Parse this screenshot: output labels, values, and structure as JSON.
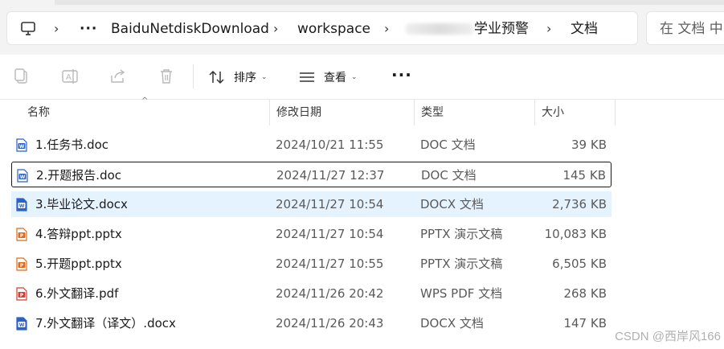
{
  "address_bar": {
    "more_glyph": "···",
    "segments": [
      "BaiduNetdiskDownload",
      "workspace",
      "学业预警",
      "文档"
    ],
    "chevron": "›"
  },
  "search": {
    "placeholder": "在 文档 中"
  },
  "toolbar": {
    "sort_label": "排序",
    "view_label": "查看",
    "more_glyph": "···",
    "caret": "⌄"
  },
  "columns": {
    "name": "名称",
    "modified": "修改日期",
    "type": "类型",
    "size": "大小",
    "sort_indicator": "^"
  },
  "files": [
    {
      "name": "1.任务书.doc",
      "modified": "2024/10/21 11:55",
      "type": "DOC 文档",
      "size": "39 KB",
      "icon": "word-doc-icon",
      "state": "normal"
    },
    {
      "name": "2.开题报告.doc",
      "modified": "2024/11/27 12:37",
      "type": "DOC 文档",
      "size": "145 KB",
      "icon": "word-doc-icon",
      "state": "focused"
    },
    {
      "name": "3.毕业论文.docx",
      "modified": "2024/11/27 10:54",
      "type": "DOCX 文档",
      "size": "2,736 KB",
      "icon": "word-docx-icon",
      "state": "selected"
    },
    {
      "name": "4.答辩ppt.pptx",
      "modified": "2024/11/27 10:54",
      "type": "PPTX 演示文稿",
      "size": "10,083 KB",
      "icon": "pptx-icon",
      "state": "normal"
    },
    {
      "name": "5.开题ppt.pptx",
      "modified": "2024/11/27 10:55",
      "type": "PPTX 演示文稿",
      "size": "6,505 KB",
      "icon": "pptx-icon",
      "state": "normal"
    },
    {
      "name": "6.外文翻译.pdf",
      "modified": "2024/11/26 20:42",
      "type": "WPS PDF 文档",
      "size": "268 KB",
      "icon": "pdf-icon",
      "state": "normal"
    },
    {
      "name": "7.外文翻译（译文）.docx",
      "modified": "2024/11/26 20:43",
      "type": "DOCX 文档",
      "size": "147 KB",
      "icon": "word-docx-icon",
      "state": "normal"
    }
  ],
  "colors": {
    "word": "#2b62c8",
    "pptx": "#e06a1b",
    "pdf": "#d93b30",
    "selected_bg": "#e5f3ff"
  },
  "watermark": "CSDN @西岸风166"
}
